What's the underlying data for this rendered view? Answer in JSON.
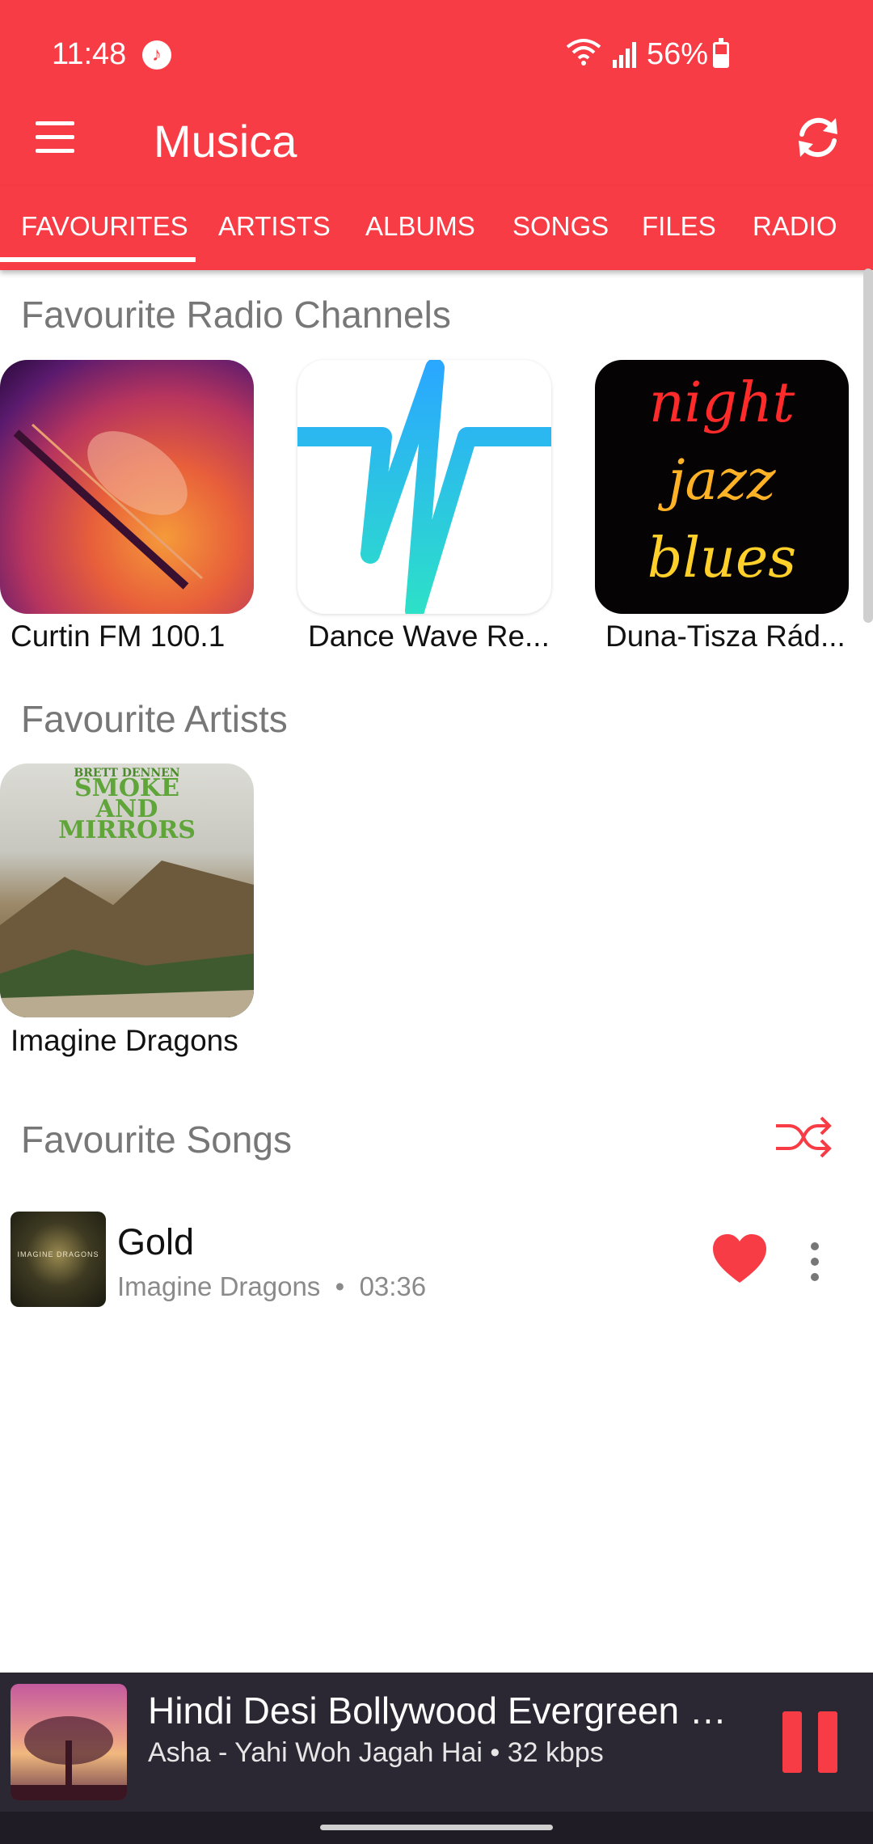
{
  "status": {
    "time": "11:48",
    "battery": "56%"
  },
  "app": {
    "title": "Musica"
  },
  "tabs": [
    "FAVOURITES",
    "ARTISTS",
    "ALBUMS",
    "SONGS",
    "FILES",
    "RADIO"
  ],
  "sections": {
    "radio": {
      "title": "Favourite Radio Channels",
      "items": [
        "Curtin FM 100.1",
        "Dance Wave Re...",
        "Duna-Tisza Rád..."
      ]
    },
    "artists": {
      "title": "Favourite Artists",
      "items": [
        "Imagine Dragons"
      ],
      "art_text": [
        "BRETT DENNEN",
        "SMOKE",
        "AND",
        "MIRRORS"
      ]
    },
    "songs": {
      "title": "Favourite Songs",
      "items": [
        {
          "title": "Gold",
          "artist": "Imagine Dragons",
          "separator": "•",
          "duration": "03:36",
          "art_text": "IMAGINE DRAGONS"
        }
      ]
    }
  },
  "night_art": [
    "night",
    "jazz",
    "blues"
  ],
  "player": {
    "title": "Hindi Desi Bollywood Evergreen H...",
    "subtitle": "Asha - Yahi Woh Jagah Hai • 32 kbps"
  },
  "icons": {
    "menu": "hamburger-icon",
    "refresh": "refresh-icon",
    "shuffle": "shuffle-icon",
    "heart": "heart-icon",
    "more": "more-vertical-icon",
    "pause": "pause-icon",
    "music": "music-note-icon",
    "wifi": "wifi-icon",
    "signal": "signal-icon",
    "battery": "battery-icon"
  },
  "colors": {
    "accent": "#f73c46",
    "player_bg": "#2b2733",
    "muted_text": "#777777"
  }
}
